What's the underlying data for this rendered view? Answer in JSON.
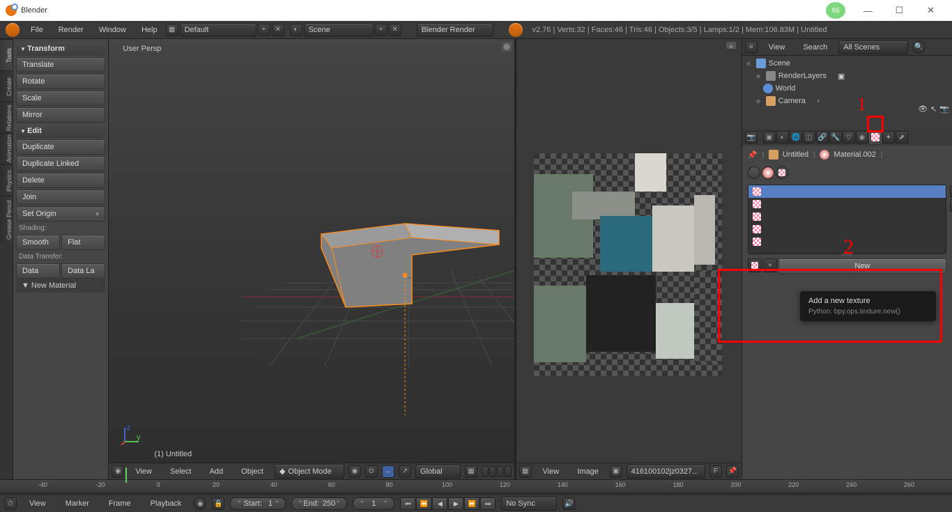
{
  "window": {
    "title": "Blender",
    "badge": "65"
  },
  "menubar": {
    "items": [
      "File",
      "Render",
      "Window",
      "Help"
    ],
    "layout_sel": "Default",
    "scene_sel": "Scene",
    "engine_sel": "Blender Render",
    "status": "v2.76 | Verts:32 | Faces:46 | Tris:46 | Objects:3/5 | Lamps:1/2 | Mem:106.83M | Untitled"
  },
  "left_tabs": [
    "Tools",
    "Create",
    "Relations",
    "Animation",
    "Physics",
    "Grease Pencil"
  ],
  "toolshelf": {
    "transform": {
      "title": "Transform",
      "translate": "Translate",
      "rotate": "Rotate",
      "scale": "Scale",
      "mirror": "Mirror"
    },
    "edit": {
      "title": "Edit",
      "duplicate": "Duplicate",
      "duplink": "Duplicate Linked",
      "delete": "Delete",
      "join": "Join",
      "setorigin": "Set Origin"
    },
    "shading": {
      "label": "Shading:",
      "smooth": "Smooth",
      "flat": "Flat"
    },
    "datatransfer": {
      "label": "Data Transfer:",
      "data": "Data",
      "datala": "Data La"
    },
    "newmat": "New Material"
  },
  "viewport3d": {
    "label": "User Persp",
    "object_label": "(1) Untitled",
    "header": {
      "view": "View",
      "select": "Select",
      "add": "Add",
      "object": "Object",
      "mode": "Object Mode",
      "orient": "Global"
    }
  },
  "uv": {
    "header": {
      "view": "View",
      "image": "Image",
      "filename": "416100102jz0327...",
      "fbtn": "F"
    }
  },
  "outliner": {
    "header": {
      "view": "View",
      "search": "Search",
      "filter": "All Scenes"
    },
    "scene": "Scene",
    "renderlayers": "RenderLayers",
    "world": "World",
    "camera": "Camera"
  },
  "properties": {
    "breadcrumb": {
      "obj": "Untitled",
      "mat": "Material.002"
    },
    "new_btn": "New",
    "tooltip": {
      "title": "Add a new texture",
      "sub": "Python: bpy.ops.texture.new()"
    }
  },
  "annotation": {
    "one": "1",
    "two": "2"
  },
  "timeline": {
    "ticks": [
      "-40",
      "-20",
      "0",
      "20",
      "40",
      "60",
      "80",
      "100",
      "120",
      "140",
      "160",
      "180",
      "200",
      "220",
      "240",
      "260"
    ],
    "header": {
      "view": "View",
      "marker": "Marker",
      "frame": "Frame",
      "playback": "Playback",
      "start_lbl": "Start:",
      "start": "1",
      "end_lbl": "End:",
      "end": "250",
      "cur": "1",
      "sync": "No Sync"
    }
  }
}
